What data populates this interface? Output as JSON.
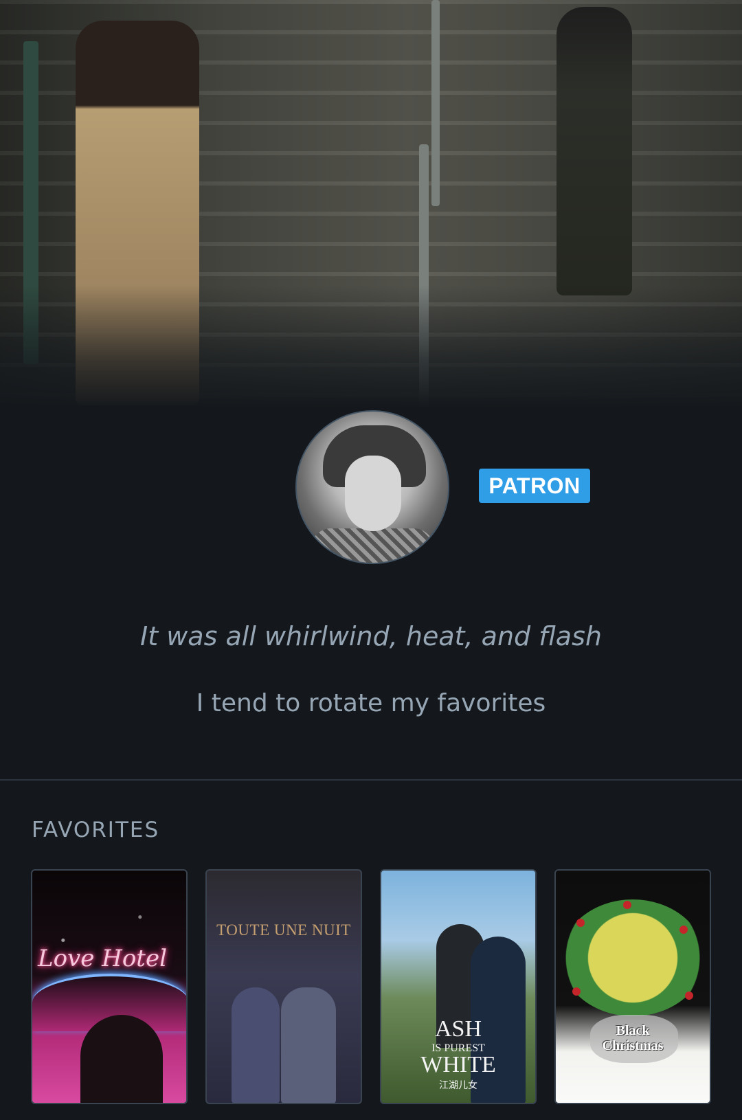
{
  "profile": {
    "badge_label": "PATRON",
    "tagline": "It was all whirlwind, heat, and flash",
    "bio": "I tend to rotate my favorites"
  },
  "favorites": {
    "section_title": "FAVORITES",
    "posters": [
      {
        "title": "Love Hotel",
        "art_text": "Love Hotel"
      },
      {
        "title": "Toute une nuit",
        "art_text": "TOUTE UNE NUIT"
      },
      {
        "title": "Ash Is Purest White",
        "art_text_1": "ASH",
        "art_text_2": "IS PUREST",
        "art_text_3": "WHITE",
        "art_text_4": "江湖儿女"
      },
      {
        "title": "Black Christmas",
        "art_text_1": "Black",
        "art_text_2": "Christmas"
      }
    ]
  },
  "colors": {
    "background": "#14181c",
    "badge": "#2f9ee7",
    "text_muted": "#97a6b4",
    "divider": "#2c3440"
  }
}
